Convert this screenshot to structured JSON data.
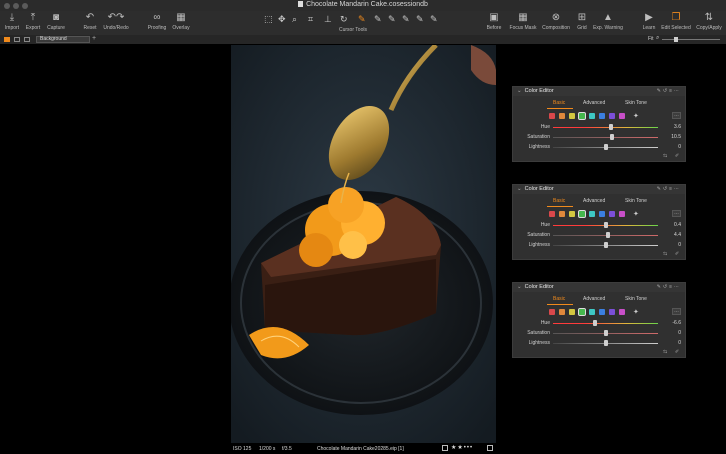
{
  "window": {
    "title": "Chocolate Mandarin Cake.cosessiondb"
  },
  "toolbar": {
    "left": [
      {
        "label": "Import",
        "icon": "import-icon"
      },
      {
        "label": "Export",
        "icon": "export-icon"
      },
      {
        "label": "Capture",
        "icon": "camera-icon"
      },
      {
        "label": "Reset",
        "icon": "reset-icon"
      },
      {
        "label": "Undo/Redo",
        "icon": "undo-redo-icon"
      },
      {
        "label": "Proofing",
        "icon": "glasses-icon"
      },
      {
        "label": "Overlay",
        "icon": "overlay-icon"
      }
    ],
    "cursor_tools_label": "Cursor Tools",
    "right": [
      {
        "label": "Before",
        "icon": "before-icon"
      },
      {
        "label": "Focus Mask",
        "icon": "focus-mask-icon"
      },
      {
        "label": "Composition",
        "icon": "composition-icon"
      },
      {
        "label": "Grid",
        "icon": "grid-icon"
      },
      {
        "label": "Exp. Warning",
        "icon": "warning-icon"
      },
      {
        "label": "Learn",
        "icon": "learn-icon"
      },
      {
        "label": "Edit Selected",
        "icon": "edit-selected-icon"
      },
      {
        "label": "Copy/Apply",
        "icon": "copy-apply-icon"
      }
    ]
  },
  "subbar": {
    "background_select": "Background",
    "zoom_label": "Fit"
  },
  "viewer": {
    "iso": "ISO 125",
    "shutter": "1/200 s",
    "aperture": "f/3.5",
    "filename": "Chocolate Mandarin Cake20285.eip [1]"
  },
  "panels": [
    {
      "title": "Color Editor",
      "tabs": [
        "Basic",
        "Advanced",
        "Skin Tone"
      ],
      "active_tab": "Basic",
      "sliders": [
        {
          "label": "Hue",
          "value": "3.6",
          "knob": 0.55
        },
        {
          "label": "Saturation",
          "value": "10.5",
          "knob": 0.56
        },
        {
          "label": "Lightness",
          "value": "0",
          "knob": 0.5
        }
      ]
    },
    {
      "title": "Color Editor",
      "tabs": [
        "Basic",
        "Advanced",
        "Skin Tone"
      ],
      "active_tab": "Basic",
      "sliders": [
        {
          "label": "Hue",
          "value": "0.4",
          "knob": 0.5
        },
        {
          "label": "Saturation",
          "value": "4.4",
          "knob": 0.52
        },
        {
          "label": "Lightness",
          "value": "0",
          "knob": 0.5
        }
      ]
    },
    {
      "title": "Color Editor",
      "tabs": [
        "Basic",
        "Advanced",
        "Skin Tone"
      ],
      "active_tab": "Basic",
      "sliders": [
        {
          "label": "Hue",
          "value": "-6.6",
          "knob": 0.4
        },
        {
          "label": "Saturation",
          "value": "0",
          "knob": 0.5
        },
        {
          "label": "Lightness",
          "value": "0",
          "knob": 0.5
        }
      ]
    }
  ],
  "swatch_colors": [
    "#d9484b",
    "#e0883c",
    "#d3c640",
    "#45b84d",
    "#3ec7c4",
    "#3b7fe0",
    "#7b4fd8",
    "#c84fc8"
  ],
  "colors": {
    "accent": "#f08a1c",
    "panel_bg": "#303030",
    "toolbar_bg": "#2d2d2d"
  }
}
